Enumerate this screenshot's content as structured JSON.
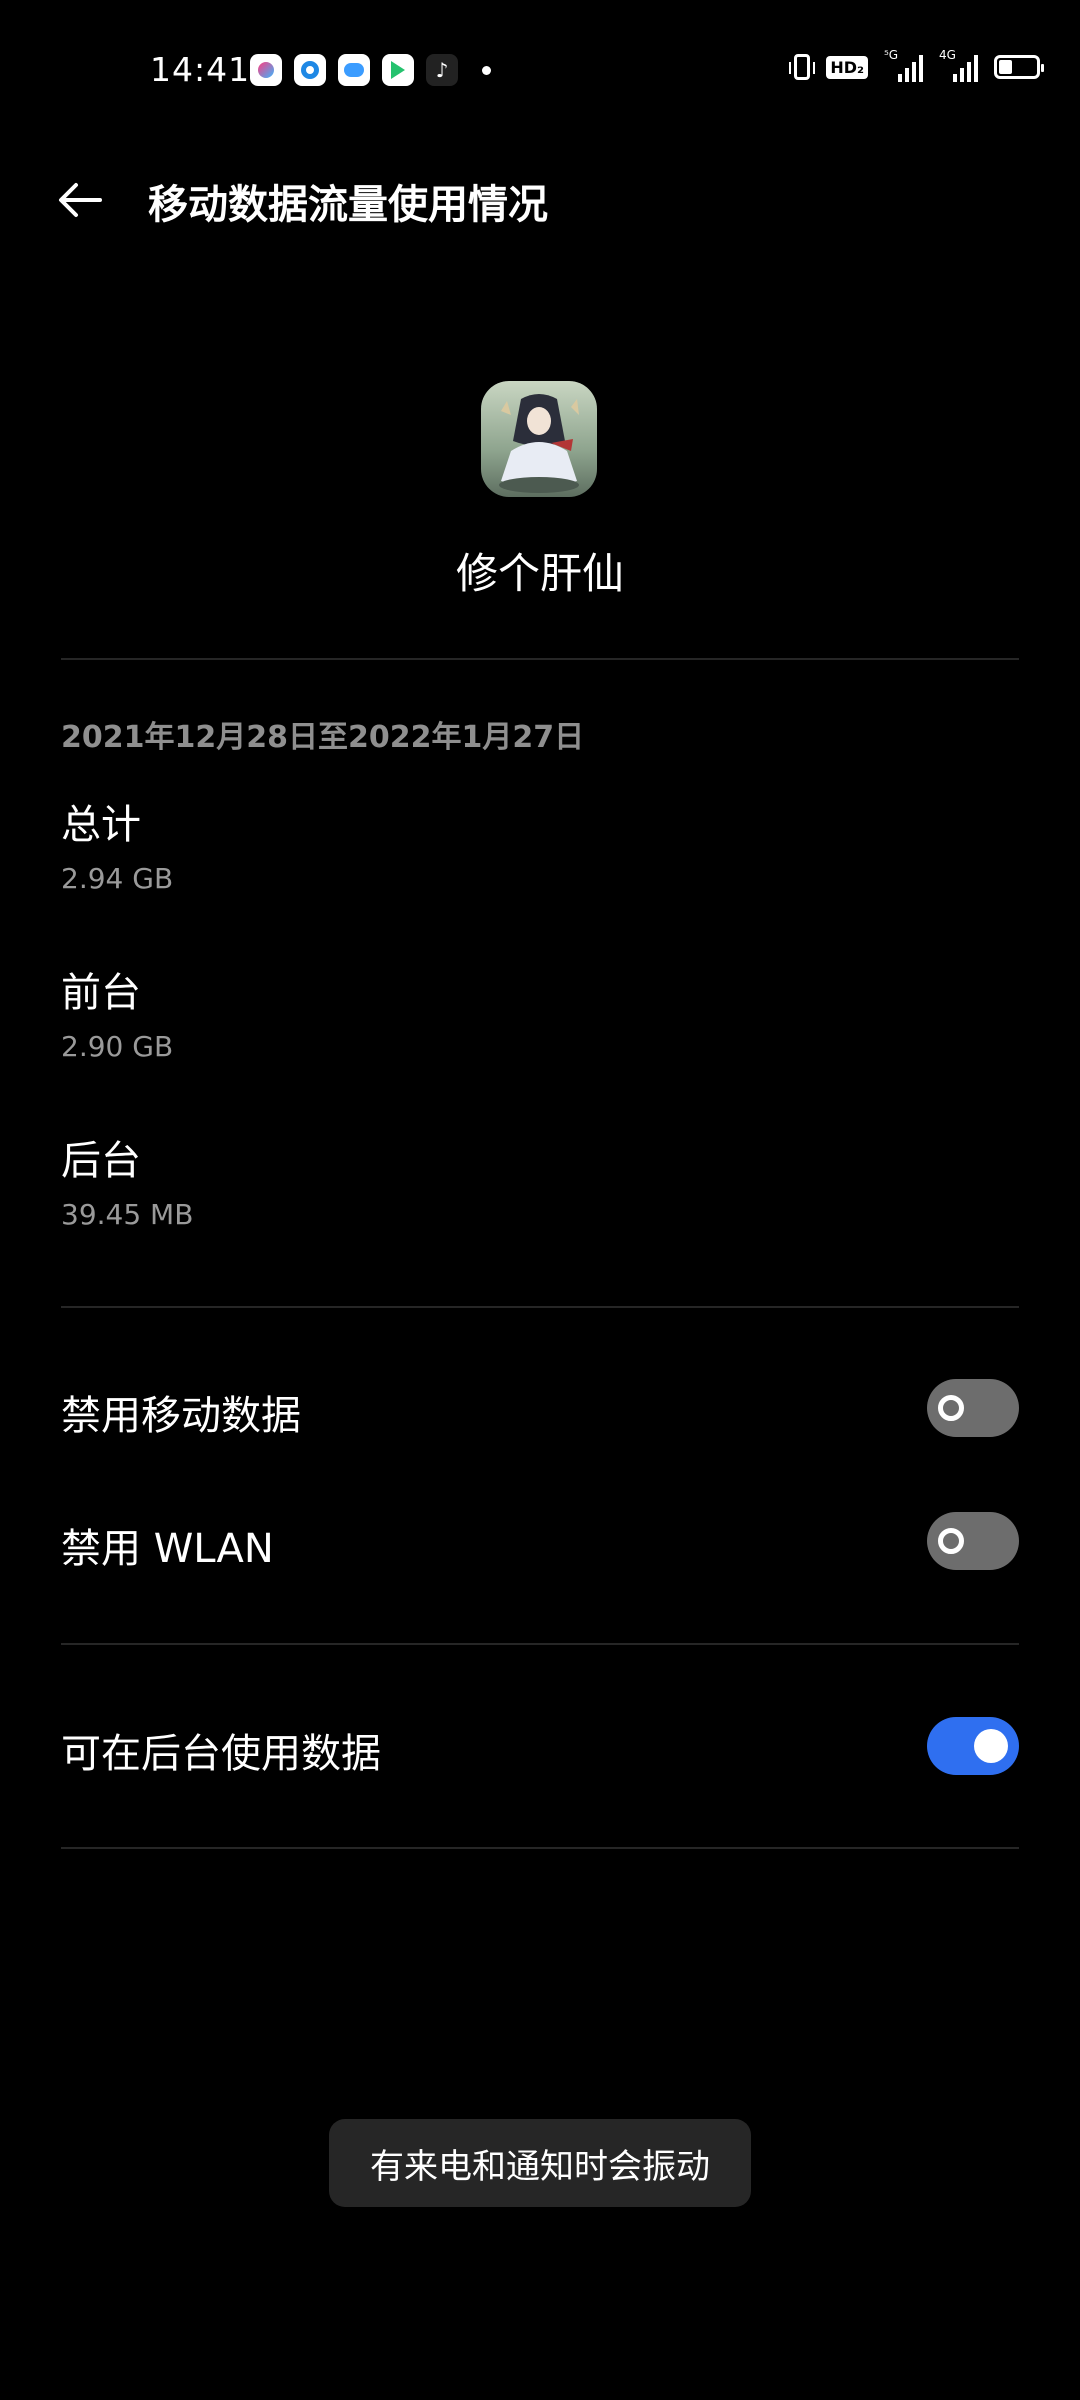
{
  "status_bar": {
    "time": "14:41",
    "notification_icons": [
      "youku-icon",
      "blue-ring-app-icon",
      "cloud-app-icon",
      "video-app-icon",
      "tiktok-icon"
    ],
    "hd_label": "HD₂",
    "signal_1_label": "⁵G",
    "signal_2_label": "4G",
    "battery_level": 0.35
  },
  "header": {
    "back_icon": "arrow-left-icon",
    "title": "移动数据流量使用情况"
  },
  "app": {
    "name": "修个肝仙"
  },
  "usage": {
    "date_range": "2021年12月28日至2022年1月27日",
    "items": [
      {
        "label": "总计",
        "value": "2.94 GB"
      },
      {
        "label": "前台",
        "value": "2.90 GB"
      },
      {
        "label": "后台",
        "value": "39.45 MB"
      }
    ]
  },
  "settings": {
    "disable_mobile_data": {
      "label": "禁用移动数据",
      "enabled": false
    },
    "disable_wlan": {
      "label": "禁用 WLAN",
      "enabled": false
    },
    "background_data": {
      "label": "可在后台使用数据",
      "enabled": true
    }
  },
  "toast": {
    "text": "有来电和通知时会振动"
  },
  "colors": {
    "background": "#000000",
    "toggle_on": "#2f6ff0",
    "toggle_off": "#6d6d6d",
    "secondary_text": "#9a9a9a"
  }
}
